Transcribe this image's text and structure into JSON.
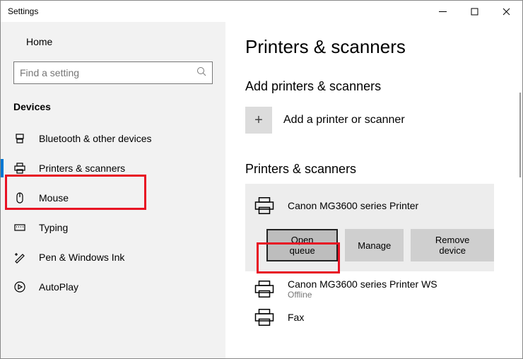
{
  "window": {
    "title": "Settings"
  },
  "sidebar": {
    "home": "Home",
    "search_placeholder": "Find a setting",
    "section": "Devices",
    "items": [
      {
        "label": "Bluetooth & other devices"
      },
      {
        "label": "Printers & scanners"
      },
      {
        "label": "Mouse"
      },
      {
        "label": "Typing"
      },
      {
        "label": "Pen & Windows Ink"
      },
      {
        "label": "AutoPlay"
      }
    ]
  },
  "main": {
    "title": "Printers & scanners",
    "add_section": "Add printers & scanners",
    "add_label": "Add a printer or scanner",
    "list_section": "Printers & scanners",
    "devices": [
      {
        "name": "Canon MG3600 series Printer",
        "status": ""
      },
      {
        "name": "Canon MG3600 series Printer WS",
        "status": "Offline"
      },
      {
        "name": "Fax",
        "status": ""
      }
    ],
    "buttons": {
      "open_queue": "Open queue",
      "manage": "Manage",
      "remove": "Remove device"
    }
  }
}
